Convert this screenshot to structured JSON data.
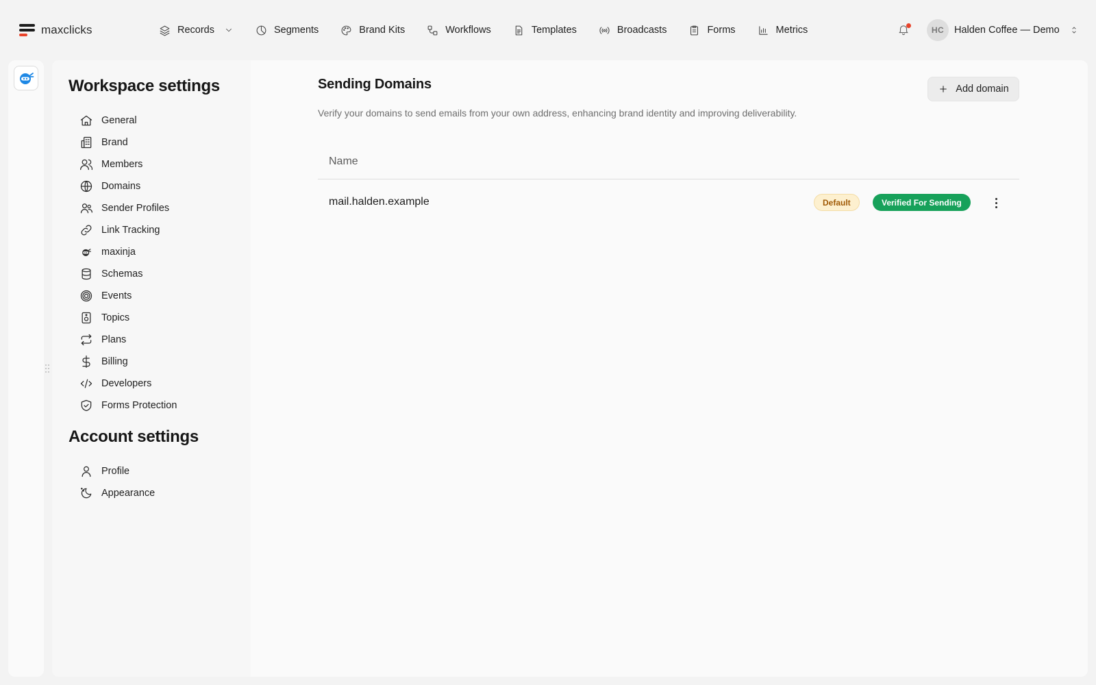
{
  "brand": {
    "name": "maxclicks"
  },
  "topnav": {
    "items": [
      {
        "label": "Records",
        "icon": "layers-icon",
        "has_dropdown": true
      },
      {
        "label": "Segments",
        "icon": "pie-chart-icon"
      },
      {
        "label": "Brand Kits",
        "icon": "palette-icon"
      },
      {
        "label": "Workflows",
        "icon": "workflow-icon"
      },
      {
        "label": "Templates",
        "icon": "document-icon"
      },
      {
        "label": "Broadcasts",
        "icon": "broadcast-icon"
      },
      {
        "label": "Forms",
        "icon": "clipboard-icon"
      },
      {
        "label": "Metrics",
        "icon": "bar-chart-icon"
      }
    ],
    "notifications_unread": true,
    "account": {
      "initials": "HC",
      "name": "Halden Coffee — Demo"
    }
  },
  "workspace_settings": {
    "title": "Workspace settings",
    "items": [
      {
        "label": "General",
        "icon": "home-icon"
      },
      {
        "label": "Brand",
        "icon": "building-icon"
      },
      {
        "label": "Members",
        "icon": "users-icon"
      },
      {
        "label": "Domains",
        "icon": "globe-icon"
      },
      {
        "label": "Sender Profiles",
        "icon": "user-group-icon"
      },
      {
        "label": "Link Tracking",
        "icon": "link-icon"
      },
      {
        "label": "maxinja",
        "icon": "ninja-icon"
      },
      {
        "label": "Schemas",
        "icon": "database-icon"
      },
      {
        "label": "Events",
        "icon": "target-icon"
      },
      {
        "label": "Topics",
        "icon": "speaker-icon"
      },
      {
        "label": "Plans",
        "icon": "repeat-icon"
      },
      {
        "label": "Billing",
        "icon": "dollar-icon"
      },
      {
        "label": "Developers",
        "icon": "code-icon"
      },
      {
        "label": "Forms Protection",
        "icon": "shield-check-icon"
      }
    ]
  },
  "account_settings": {
    "title": "Account settings",
    "items": [
      {
        "label": "Profile",
        "icon": "user-icon"
      },
      {
        "label": "Appearance",
        "icon": "moon-icon"
      }
    ]
  },
  "main": {
    "title": "Sending Domains",
    "description": "Verify your domains to send emails from your own address, enhancing brand identity and improving deliverability.",
    "add_button": "Add domain",
    "table": {
      "columns": [
        "Name"
      ],
      "rows": [
        {
          "name": "mail.halden.example",
          "default_badge": "Default",
          "status_badge": "Verified For Sending"
        }
      ]
    }
  },
  "colors": {
    "accent_orange": "#e8432a",
    "verified_green": "#17a15a",
    "default_badge_bg": "#fdf0cf",
    "default_badge_text": "#a05a06",
    "rail_icon_blue": "#1e88e5"
  }
}
